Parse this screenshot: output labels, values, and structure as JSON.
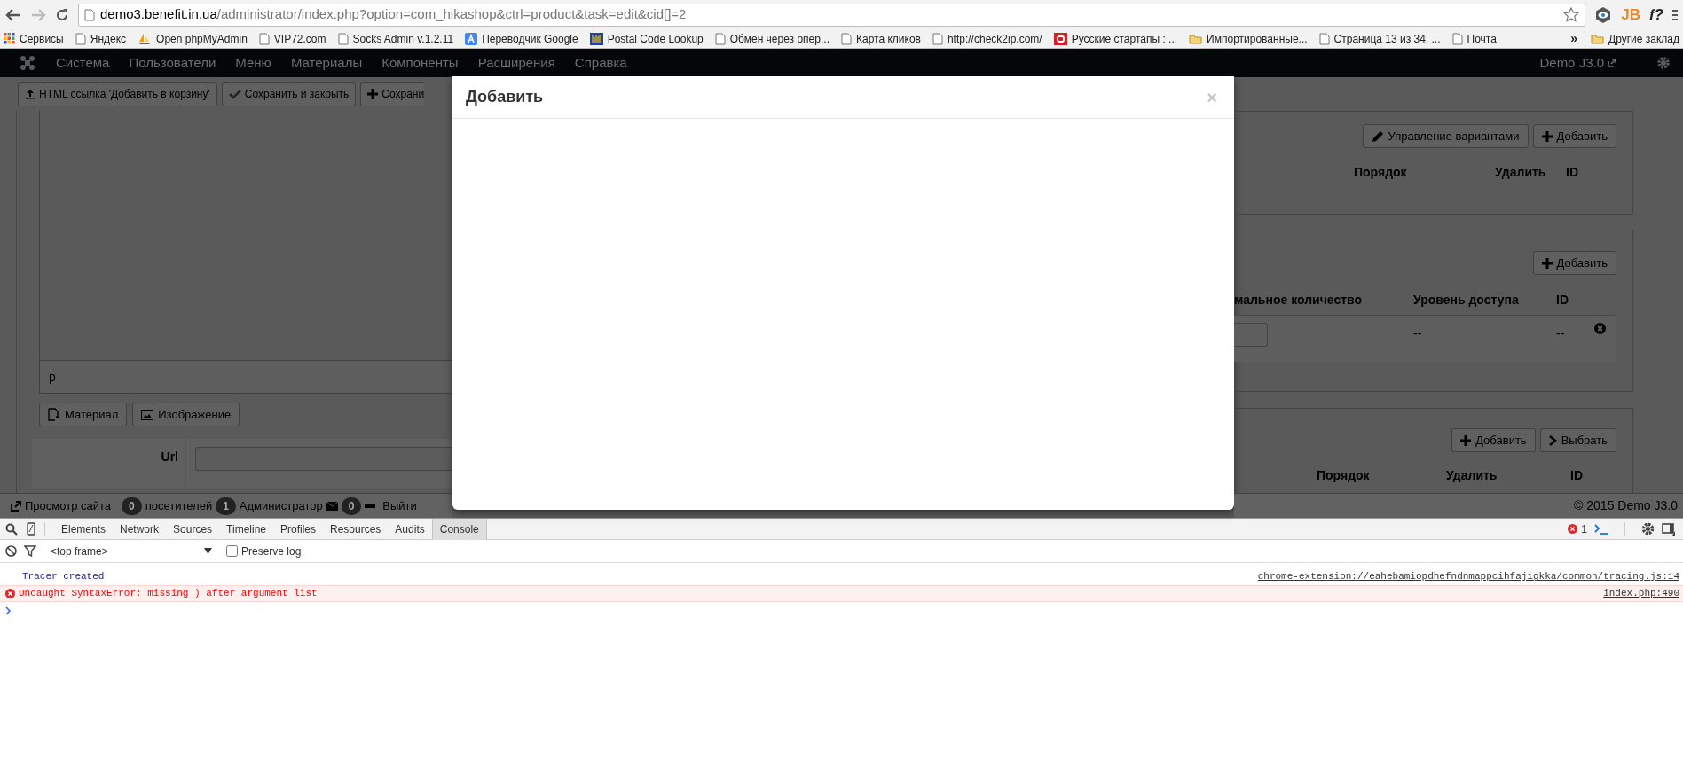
{
  "browser": {
    "url_host": "demo3.benefit.in.ua",
    "url_path": "/administrator/index.php?option=com_hikashop&ctrl=product&task=edit&cid[]=2",
    "extension_labels": [
      "JB",
      "f?"
    ]
  },
  "bookmarks": [
    {
      "label": "Сервисы",
      "kind": "apps"
    },
    {
      "label": "Яндекс",
      "kind": "page"
    },
    {
      "label": "Open phpMyAdmin",
      "kind": "pma"
    },
    {
      "label": "VIP72.com",
      "kind": "page"
    },
    {
      "label": "Socks Admin v.1.2.11",
      "kind": "page"
    },
    {
      "label": "Переводчик Google",
      "kind": "translate"
    },
    {
      "label": "Postal Code Lookup",
      "kind": "postal"
    },
    {
      "label": "Обмен через опер...",
      "kind": "page"
    },
    {
      "label": "Карта кликов",
      "kind": "page"
    },
    {
      "label": "http://check2ip.com/",
      "kind": "page"
    },
    {
      "label": "Русские стартапы : ...",
      "kind": "red"
    },
    {
      "label": "Импортированные...",
      "kind": "folder"
    },
    {
      "label": "Страница 13 из 34: ...",
      "kind": "page"
    },
    {
      "label": "Почта",
      "kind": "page"
    }
  ],
  "bookmarks_more": "»",
  "other_bookmarks": {
    "label": "Другие заклад",
    "kind": "folder"
  },
  "admin_menu": {
    "items": [
      "Система",
      "Пользователи",
      "Меню",
      "Материалы",
      "Компоненты",
      "Расширения",
      "Справка"
    ],
    "site_name": "Demo J3.0"
  },
  "toolbar": {
    "buttons": [
      {
        "label": "HTML ссылка 'Добавить в корзину'",
        "kind": "upload"
      },
      {
        "label": "Сохранить и закрыть",
        "kind": "check"
      },
      {
        "label": "Сохрани",
        "kind": "plus"
      }
    ]
  },
  "editor": {
    "path": "p",
    "buttons": [
      {
        "label": "Материал",
        "kind": "article"
      },
      {
        "label": "Изображение",
        "kind": "image"
      }
    ]
  },
  "url_field": {
    "label": "Url"
  },
  "variants_panel": {
    "buttons": [
      {
        "label": "Управление вариантами",
        "kind": "pencil"
      },
      {
        "label": "Добавить",
        "kind": "plus"
      }
    ],
    "columns": [
      "Порядок",
      "Удалить",
      "ID"
    ]
  },
  "prices_panel": {
    "buttons": [
      {
        "label": "Добавить",
        "kind": "plus"
      }
    ],
    "columns": [
      "мальное количество",
      "Уровень доступа",
      "ID"
    ],
    "row": [
      "--",
      "--"
    ]
  },
  "files_panel": {
    "buttons": [
      {
        "label": "Добавить",
        "kind": "plus"
      },
      {
        "label": "Выбрать",
        "kind": "chevron"
      }
    ],
    "columns": [
      "Порядок",
      "Удалить",
      "ID"
    ]
  },
  "status_bar": [
    {
      "kind": "site",
      "label": "Просмотр сайта"
    },
    {
      "kind": "badge",
      "label": "0"
    },
    {
      "kind": "text",
      "label": "посетителей"
    },
    {
      "kind": "badge",
      "label": "1"
    },
    {
      "kind": "text",
      "label": "Администратор"
    },
    {
      "kind": "mail"
    },
    {
      "kind": "badge",
      "label": "0"
    },
    {
      "kind": "logout",
      "label": "Выйти"
    }
  ],
  "copyright": "© 2015 Demo J3.0",
  "modal": {
    "title": "Добавить",
    "close": "×"
  },
  "devtools": {
    "tabs": [
      {
        "label": "Elements",
        "selected": false
      },
      {
        "label": "Network",
        "selected": false
      },
      {
        "label": "Sources",
        "selected": false
      },
      {
        "label": "Timeline",
        "selected": false
      },
      {
        "label": "Profiles",
        "selected": false
      },
      {
        "label": "Resources",
        "selected": false
      },
      {
        "label": "Audits",
        "selected": false
      },
      {
        "label": "Console",
        "selected": true
      }
    ],
    "error_count": "1",
    "frame": "<top frame>",
    "preserve_log": {
      "label": "Preserve log",
      "checked": false
    },
    "messages": [
      {
        "kind": "log",
        "text": "Tracer created",
        "source": "chrome-extension://eahebamiopdhefndnmappcihfajigkka/common/tracing.js:14"
      },
      {
        "kind": "error",
        "text": "Uncaught SyntaxError: missing ) after argument list",
        "source": "index.php:490"
      }
    ]
  }
}
